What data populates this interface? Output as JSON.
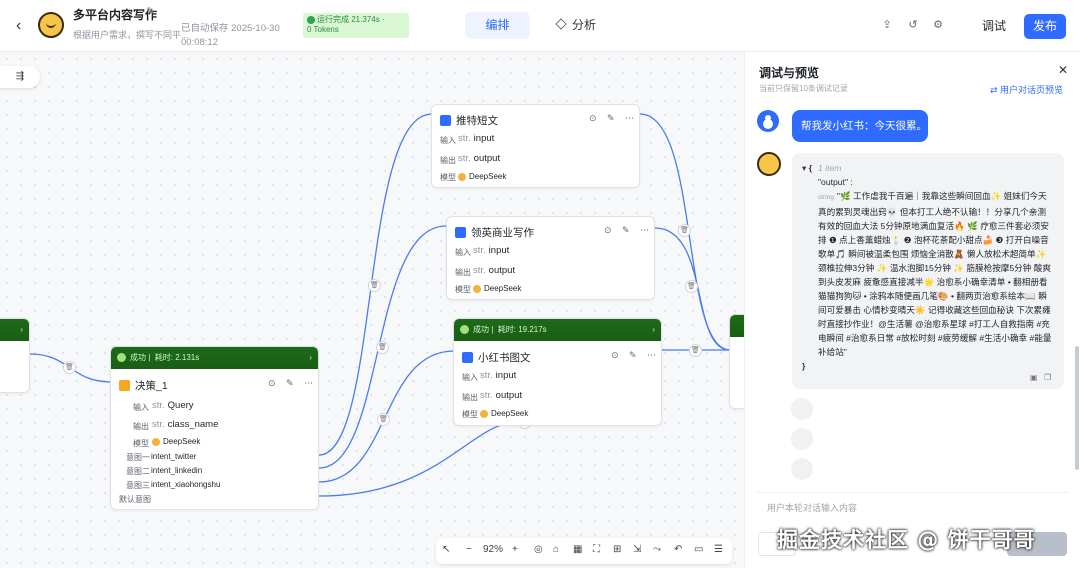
{
  "header": {
    "app_title": "多平台内容写作",
    "app_desc": "根据用户需求，撰写不同平...",
    "autosave_line1": "已自动保存 2025-10-30",
    "autosave_line2": "00:08:12",
    "run_status": "运行完成 21.374s ·",
    "run_tokens": "0 Tokens",
    "tab_edit": "编排",
    "tab_analysis": "分析",
    "debug_label": "调试",
    "publish_label": "发布"
  },
  "canvas": {
    "nodes": {
      "twitter": {
        "title": "推特短文",
        "in_label": "输入",
        "in_type": "str.",
        "in_val": "input",
        "out_label": "输出",
        "out_type": "str.",
        "out_val": "output",
        "model_label": "模型",
        "model": "DeepSeek"
      },
      "linkedin": {
        "title": "领英商业写作",
        "in_label": "输入",
        "in_type": "str.",
        "in_val": "input",
        "out_label": "输出",
        "out_type": "str.",
        "out_val": "output",
        "model_label": "模型",
        "model": "DeepSeek"
      },
      "xiaohongshu": {
        "status": "成功",
        "time": "耗时: 19.217s",
        "title": "小红书图文",
        "in_label": "输入",
        "in_type": "str.",
        "in_val": "input",
        "out_label": "输出",
        "out_type": "str.",
        "out_val": "output",
        "model_label": "模型",
        "model": "DeepSeek"
      },
      "decision": {
        "status": "成功",
        "time": "耗时: 2.131s",
        "title": "决策_1",
        "in_label": "输入",
        "in_type": "str.",
        "in_val": "Query",
        "out_label": "输出",
        "out_type": "str.",
        "out_val": "class_name",
        "model_label": "模型",
        "model": "DeepSeek",
        "intents": [
          {
            "label": "意图一",
            "value": "intent_twitter"
          },
          {
            "label": "意图二",
            "value": "intent_linkedin"
          },
          {
            "label": "意图三",
            "value": "intent_xiaohongshu"
          }
        ],
        "default_intent": "默认意图"
      }
    },
    "zoom": "92%"
  },
  "panel": {
    "title": "调试与预览",
    "subtitle": "当前只保留10条调试记录",
    "link": "用户对话页预览",
    "user_message": "帮我发小红书：今天很累。",
    "json_meta": "1 item",
    "json_key": "\"output\" :",
    "json_type": "string",
    "json_value": "\"🌿 工作虐我千百遍｜我靠这些瞬间回血✨ 姐妹们今天真的累到灵魂出窍💀 但本打工人绝不认输！！分享几个亲测有效的回血大法 5分钟原地满血复活🔥 🌿 疗愈三件套必须安排 ❶ 点上香薰蜡烛🕯️ ❷ 泡杯花茶配小甜点🍰 ❸ 打开白噪音歌单🎵 瞬间被温柔包围 烦恼全消散🧸 懒人放松术超简单✨ 颈椎拉伸3分钟 ✨ 温水泡脚15分钟 ✨ 筋膜枪按摩5分钟 酸爽到头皮发麻 疲惫感直接减半🌟 治愈系小确幸清单 • 翻相册看猫猫狗狗🐱 • 涂鸦本随便画几笔🎨 • 翻两页治愈系绘本📖 瞬间可爱暴击 心情秒变晴天☀️ 记得收藏这些回血秘诀 下次累瘫时直接抄作业！@生活薯 @治愈系星球 #打工人自救指南 #充电瞬间 #治愈系日常 #放松时刻 #疲劳缓解 #生活小确幸 #能量补给站\"",
    "input_placeholder": "用户本轮对话输入内容"
  },
  "watermark": "掘金技术社区 @ 饼干哥哥"
}
